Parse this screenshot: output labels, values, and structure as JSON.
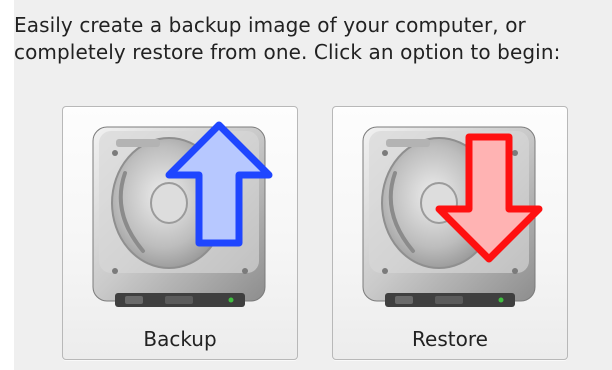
{
  "intro": {
    "line1": "Easily create a backup image of your computer, or",
    "line2": "completely restore from one. Click an option to begin:"
  },
  "options": [
    {
      "label": "Backup",
      "icon": "backup-drive-up-arrow-icon",
      "arrow_fill": "#b7c8ff",
      "arrow_stroke": "#1f46ff"
    },
    {
      "label": "Restore",
      "icon": "restore-drive-down-arrow-icon",
      "arrow_fill": "#ffb3b3",
      "arrow_stroke": "#ff1010"
    }
  ]
}
